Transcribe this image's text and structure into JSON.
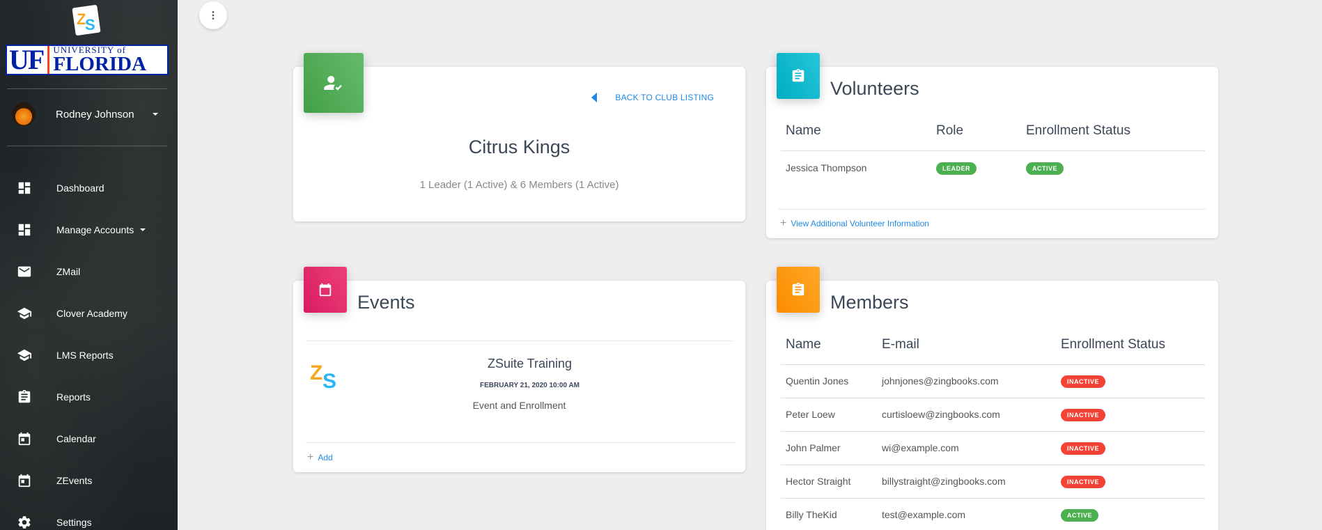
{
  "sidebar": {
    "logo_text": "ZS",
    "university": {
      "mark": "UF",
      "top": "UNIVERSITY of",
      "bottom": "FLORIDA"
    },
    "user": {
      "name": "Rodney Johnson"
    },
    "items": [
      {
        "label": "Dashboard",
        "icon": "dashboard-icon"
      },
      {
        "label": "Manage Accounts",
        "icon": "dashboard-icon"
      },
      {
        "label": "ZMail",
        "icon": "mail-icon"
      },
      {
        "label": "Clover Academy",
        "icon": "school-icon"
      },
      {
        "label": "LMS Reports",
        "icon": "school-icon"
      },
      {
        "label": "Reports",
        "icon": "clipboard-icon"
      },
      {
        "label": "Calendar",
        "icon": "calendar-icon"
      },
      {
        "label": "ZEvents",
        "icon": "calendar-icon"
      },
      {
        "label": "Settings",
        "icon": "gear-icon"
      }
    ]
  },
  "club": {
    "back_label": "BACK TO CLUB LISTING",
    "name": "Citrus Kings",
    "summary": "1 Leader (1 Active) & 6 Members (1 Active)"
  },
  "volunteers": {
    "title": "Volunteers",
    "columns": [
      "Name",
      "Role",
      "Enrollment Status"
    ],
    "rows": [
      {
        "name": "Jessica Thompson",
        "role": "LEADER",
        "status": "ACTIVE"
      }
    ],
    "footer_link": "View Additional Volunteer Information"
  },
  "events": {
    "title": "Events",
    "items": [
      {
        "title": "ZSuite Training",
        "date": "FEBRUARY 21, 2020 10:00 AM",
        "subtitle": "Event and Enrollment"
      }
    ],
    "add_label": "Add"
  },
  "members": {
    "title": "Members",
    "columns": [
      "Name",
      "E-mail",
      "Enrollment Status"
    ],
    "rows": [
      {
        "name": "Quentin Jones",
        "email": "johnjones@zingbooks.com",
        "status": "INACTIVE"
      },
      {
        "name": "Peter Loew",
        "email": "curtisloew@zingbooks.com",
        "status": "INACTIVE"
      },
      {
        "name": "John Palmer",
        "email": "wi@example.com",
        "status": "INACTIVE"
      },
      {
        "name": "Hector Straight",
        "email": "billystraight@zingbooks.com",
        "status": "INACTIVE"
      },
      {
        "name": "Billy TheKid",
        "email": "test@example.com",
        "status": "ACTIVE"
      }
    ]
  },
  "colors": {
    "active": "#4caf50",
    "inactive": "#f44336",
    "link": "#1e88e5"
  }
}
